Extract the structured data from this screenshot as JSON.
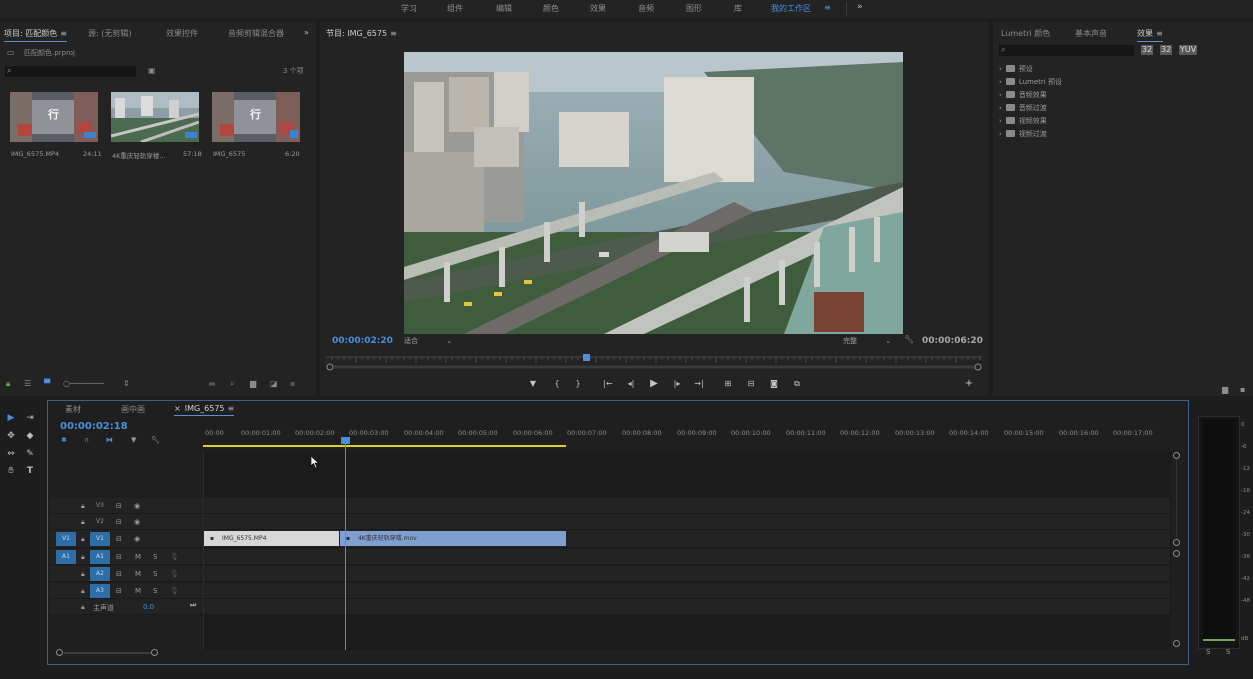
{
  "workspaces": {
    "tabs": [
      "学习",
      "组件",
      "编辑",
      "颜色",
      "效果",
      "音频",
      "图形",
      "库"
    ],
    "active": "我的工作区",
    "menu_icon": "hamburger-icon",
    "more_icon": "chevron-double-right-icon"
  },
  "project_panel": {
    "tabs": [
      "项目: 匹配颜色",
      "源: (无剪辑)",
      "效果控件",
      "音频剪辑混合器"
    ],
    "active_index": 0,
    "file_name": "匹配颜色.prproj",
    "item_count": "3 个项",
    "items": [
      {
        "name": "IMG_6575.MP4",
        "duration": "24:11"
      },
      {
        "name": "4K重庆轻轨穿楼...",
        "duration": "57:18"
      },
      {
        "name": "IMG_6575",
        "duration": "6:20"
      }
    ]
  },
  "program_monitor": {
    "title": "节目: IMG_6575",
    "current_time": "00:00:02:20",
    "fit_label": "适合",
    "quality_label": "完整",
    "duration": "00:00:06:20"
  },
  "right_panel": {
    "tabs": [
      "Lumetri 颜色",
      "基本声音",
      "效果"
    ],
    "active_index": 2,
    "effects": [
      "预设",
      "Lumetri 预设",
      "音频效果",
      "音频过渡",
      "视频效果",
      "视频过渡"
    ]
  },
  "timeline": {
    "tabs": [
      "素材",
      "画中画",
      "IMG_6575"
    ],
    "active_index": 2,
    "current_time": "00:00:02:18",
    "ruler": [
      "00:00",
      "00:00:01:00",
      "00:00:02:00",
      "00:00:03:00",
      "00:00:04:00",
      "00:00:05:00",
      "00:00:06:00",
      "00:00:07:00",
      "00:00:08:00",
      "00:00:09:00",
      "00:00:10:00",
      "00:00:11:00",
      "00:00:12:00",
      "00:00:13:00",
      "00:00:14:00",
      "00:00:15:00",
      "00:00:16:00",
      "00:00:17:00"
    ],
    "video_tracks": [
      "V3",
      "V2",
      "V1"
    ],
    "audio_tracks": [
      "A1",
      "A2",
      "A3"
    ],
    "source_v": "V1",
    "source_a": "A1",
    "mute_label": "M",
    "solo_label": "S",
    "master_label": "主声道",
    "master_value": "0.0",
    "clips": [
      {
        "name": "IMG_6575.MP4",
        "color": "#d7d7d7"
      },
      {
        "name": "4K重庆轻轨穿楼.mov",
        "color": "#7f9fd1"
      }
    ]
  },
  "meter": {
    "db_labels": [
      "0",
      "-6",
      "-12",
      "-18",
      "-24",
      "-30",
      "-36",
      "-42",
      "-48",
      "dB"
    ],
    "solo_labels": [
      "S",
      "S"
    ]
  }
}
